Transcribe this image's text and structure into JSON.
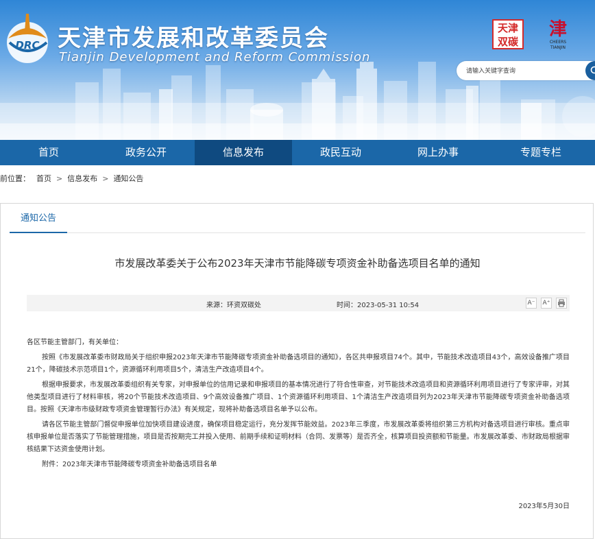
{
  "header": {
    "title": "天津市发展和改革委员会",
    "subtitle": "Tianjin Development and Reform Commission",
    "logo_text": "DRC",
    "seal1_text": "天津双碳",
    "seal2_glyph": "津",
    "seal2_caption": "CHEERS TIANJIN",
    "search_placeholder": "请输入关键字查询"
  },
  "nav": [
    {
      "label": "首页"
    },
    {
      "label": "政务公开"
    },
    {
      "label": "信息发布",
      "active": true
    },
    {
      "label": "政民互动"
    },
    {
      "label": "网上办事"
    },
    {
      "label": "专题专栏"
    }
  ],
  "breadcrumb": {
    "prefix": "前位置：",
    "items": [
      "首页",
      "信息发布",
      "通知公告"
    ]
  },
  "tab": "通知公告",
  "article": {
    "title": "市发展改革委关于公布2023年天津市节能降碳专项资金补助备选项目名单的通知",
    "source": "来源：环资双碳处",
    "time": "时间：2023-05-31 10:54",
    "tools": {
      "font_smaller": "A⁻",
      "font_larger": "A⁺"
    },
    "salutation": "各区节能主管部门，有关单位：",
    "paragraphs": [
      "按照《市发展改革委市财政局关于组织申报2023年天津市节能降碳专项资金补助备选项目的通知》，各区共申报项目74个。其中，节能技术改造项目43个，高效设备推广项目21个，降碳技术示范项目1个，资源循环利用项目5个，清洁生产改造项目4个。",
      "根据申报要求，市发展改革委组织有关专家，对申报单位的信用记录和申报项目的基本情况进行了符合性审查，对节能技术改造项目和资源循环利用项目进行了专家评审，对其他类型项目进行了材料审核，将20个节能技术改造项目、9个高效设备推广项目、1个资源循环利用项目、1个清洁生产改造项目列为2023年天津市节能降碳专项资金补助备选项目。按照《天津市市级财政专项资金管理暂行办法》有关规定，现将补助备选项目名单予以公布。",
      "请各区节能主管部门督促申报单位加快项目建设进度，确保项目稳定运行，充分发挥节能效益。2023年三季度，市发展改革委将组织第三方机构对备选项目进行审核。重点审核申报单位是否落实了节能管理措施，项目是否按期完工并投入使用、前期手续和证明材料（合同、发票等）是否齐全，核算项目投资额和节能量。市发展改革委、市财政局根据审核结果下达资金使用计划。",
      "附件：2023年天津市节能降碳专项资金补助备选项目名单"
    ],
    "sign_date": "2023年5月30日"
  },
  "colors": {
    "nav_bg": "#1b67a8",
    "nav_active": "#0f4a80",
    "accent": "#1b67a8"
  }
}
